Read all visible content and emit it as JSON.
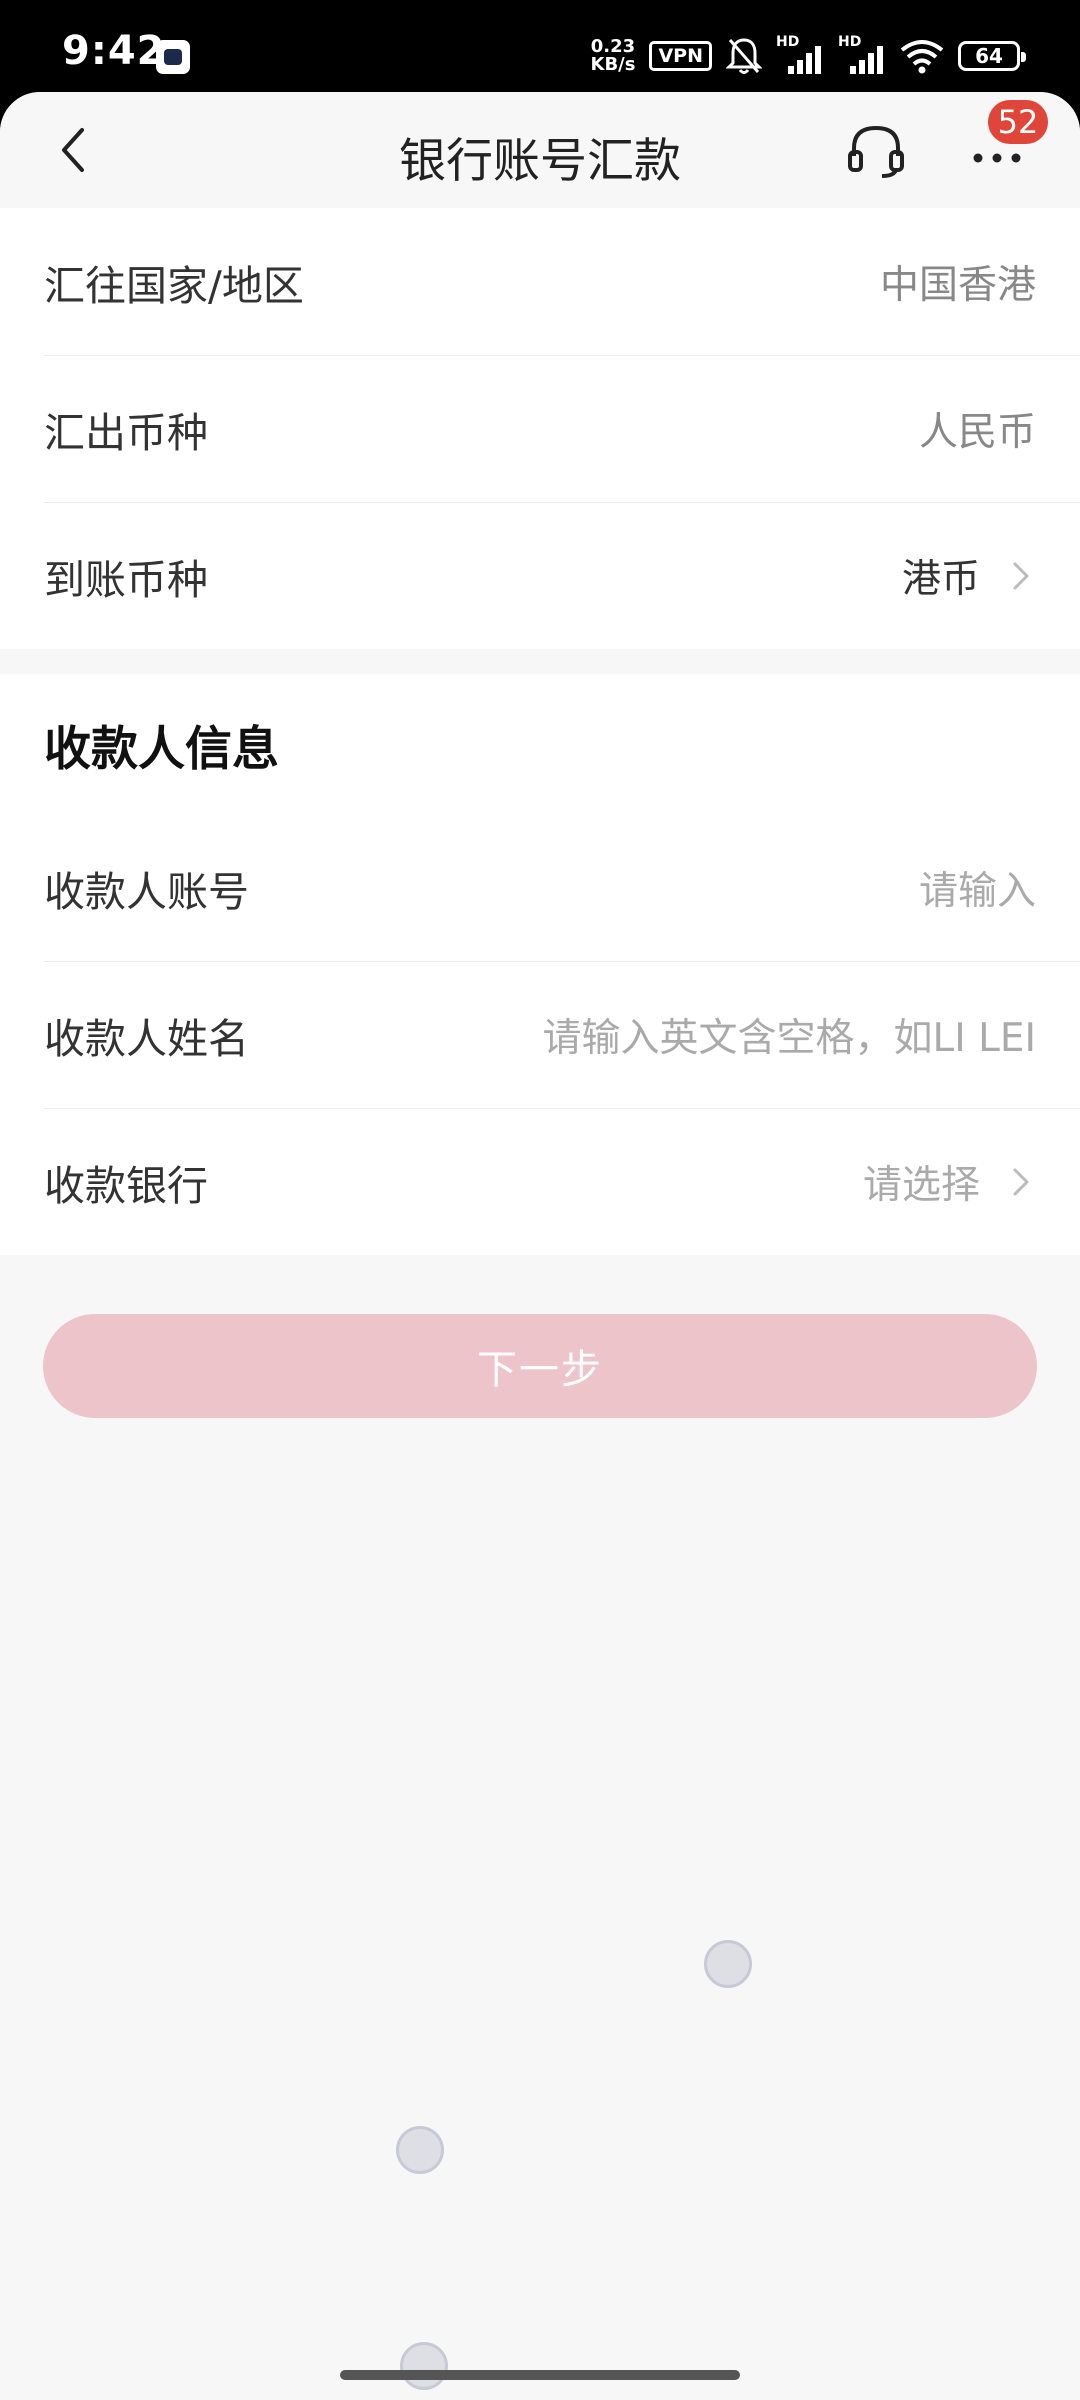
{
  "status_bar": {
    "time": "9:42",
    "net_speed_value": "0.23",
    "net_speed_unit": "KB/s",
    "vpn": "VPN",
    "signal_1": "HD",
    "signal_2": "HD",
    "battery": "64"
  },
  "nav": {
    "title": "银行账号汇款",
    "badge_count": "52",
    "back_icon": "chevron-left-icon",
    "service_icon": "headset-icon",
    "more_icon": "more-dots-icon"
  },
  "transfer": {
    "rows": [
      {
        "label": "汇往国家/地区",
        "value": "中国香港"
      },
      {
        "label": "汇出币种",
        "value": "人民币"
      },
      {
        "label": "到账币种",
        "value": "港币"
      }
    ]
  },
  "payee": {
    "section_title": "收款人信息",
    "rows": [
      {
        "label": "收款人账号",
        "placeholder": "请输入"
      },
      {
        "label": "收款人姓名",
        "placeholder": "请输入英文含空格，如LI LEI"
      },
      {
        "label": "收款银行",
        "placeholder": "请选择"
      }
    ]
  },
  "actions": {
    "next_label": "下一步"
  },
  "colors": {
    "button_disabled": "#edc4c9",
    "badge": "#e0453a",
    "background": "#f7f7f7"
  }
}
